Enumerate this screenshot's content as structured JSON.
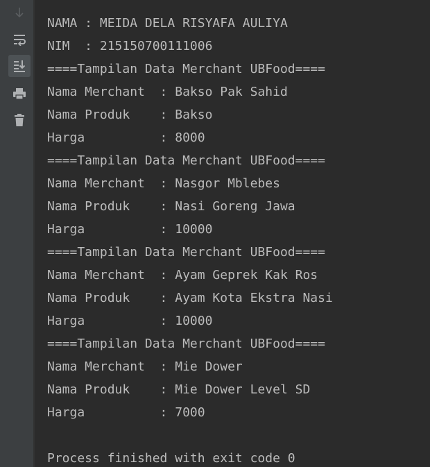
{
  "toolbar": {
    "buttons": [
      {
        "icon": "arrow-down-icon",
        "state": "disabled"
      },
      {
        "icon": "soft-wrap-icon",
        "state": "normal"
      },
      {
        "icon": "scroll-to-end-icon",
        "state": "active"
      },
      {
        "icon": "print-icon",
        "state": "normal"
      },
      {
        "icon": "trash-icon",
        "state": "normal"
      }
    ]
  },
  "colors": {
    "background": "#2b2b2b",
    "toolbar": "#3c3f41",
    "text": "#bbbbbb",
    "icon": "#afb1b3",
    "icon_disabled": "#5b5e61"
  },
  "console": {
    "lines": [
      "NAMA : MEIDA DELA RISYAFA AULIYA",
      "NIM  : 215150700111006",
      "====Tampilan Data Merchant UBFood====",
      "Nama Merchant  : Bakso Pak Sahid",
      "Nama Produk    : Bakso",
      "Harga          : 8000",
      "====Tampilan Data Merchant UBFood====",
      "Nama Merchant  : Nasgor Mblebes",
      "Nama Produk    : Nasi Goreng Jawa",
      "Harga          : 10000",
      "====Tampilan Data Merchant UBFood====",
      "Nama Merchant  : Ayam Geprek Kak Ros",
      "Nama Produk    : Ayam Kota Ekstra Nasi",
      "Harga          : 10000",
      "====Tampilan Data Merchant UBFood====",
      "Nama Merchant  : Mie Dower",
      "Nama Produk    : Mie Dower Level SD",
      "Harga          : 7000",
      "",
      "Process finished with exit code 0"
    ]
  }
}
